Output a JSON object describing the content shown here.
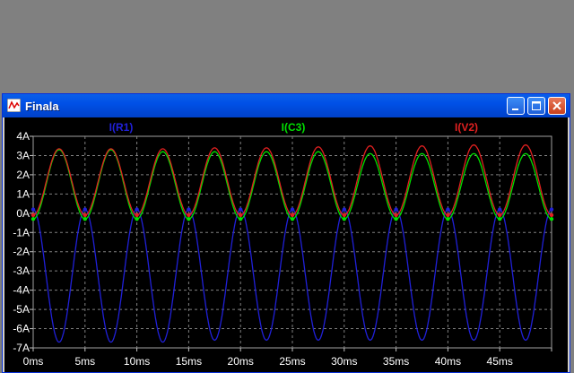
{
  "window": {
    "title": "Finala",
    "icon": "waveform-icon",
    "buttons": [
      "minimize-icon",
      "maximize-icon",
      "close-icon"
    ],
    "title_color": "#0054e3"
  },
  "chart_data": {
    "type": "line",
    "xlabel": "",
    "ylabel": "",
    "x_ticks": [
      "0ms",
      "5ms",
      "10ms",
      "15ms",
      "20ms",
      "25ms",
      "30ms",
      "35ms",
      "40ms",
      "45ms"
    ],
    "y_ticks": [
      "4A",
      "3A",
      "2A",
      "1A",
      "0A",
      "-1A",
      "-2A",
      "-3A",
      "-4A",
      "-5A",
      "-6A",
      "-7A"
    ],
    "x_range_ms": [
      0,
      50
    ],
    "y_range_A": [
      -7,
      4
    ],
    "grid": true,
    "legend": "top",
    "series": [
      {
        "name": "I(R1)",
        "color": "#2020d8",
        "x": [
          0,
          2.5,
          5,
          7.5,
          10,
          12.5,
          15,
          17.5,
          20,
          22.5,
          25,
          27.5,
          30,
          32.5,
          35,
          37.5,
          40,
          42.5,
          45,
          47.5,
          50
        ],
        "y": [
          0.2,
          -6.7,
          0.2,
          -6.7,
          0.2,
          -6.7,
          0.2,
          -6.6,
          0.2,
          -6.6,
          0.2,
          -6.6,
          0.2,
          -6.6,
          0.2,
          -6.6,
          0.2,
          -6.6,
          0.2,
          -6.6,
          0.2
        ]
      },
      {
        "name": "I(C3)",
        "color": "#00e000",
        "x": [
          0,
          2.5,
          5,
          7.5,
          10,
          12.5,
          15,
          17.5,
          20,
          22.5,
          25,
          27.5,
          30,
          32.5,
          35,
          37.5,
          40,
          42.5,
          45,
          47.5,
          50
        ],
        "y": [
          -0.3,
          3.3,
          -0.3,
          3.3,
          -0.3,
          3.2,
          -0.3,
          3.2,
          -0.3,
          3.2,
          -0.3,
          3.2,
          -0.3,
          3.1,
          -0.3,
          3.1,
          -0.3,
          3.1,
          -0.3,
          3.1,
          -0.3
        ]
      },
      {
        "name": "I(V2)",
        "color": "#e02020",
        "x": [
          0,
          2.5,
          5,
          7.5,
          10,
          12.5,
          15,
          17.5,
          20,
          22.5,
          25,
          27.5,
          30,
          32.5,
          35,
          37.5,
          40,
          42.5,
          45,
          47.5,
          50
        ],
        "y": [
          -0.1,
          3.35,
          -0.1,
          3.35,
          -0.1,
          3.35,
          -0.1,
          3.4,
          -0.1,
          3.4,
          -0.1,
          3.45,
          -0.1,
          3.5,
          -0.1,
          3.5,
          -0.1,
          3.55,
          -0.1,
          3.55,
          -0.1
        ]
      }
    ]
  }
}
